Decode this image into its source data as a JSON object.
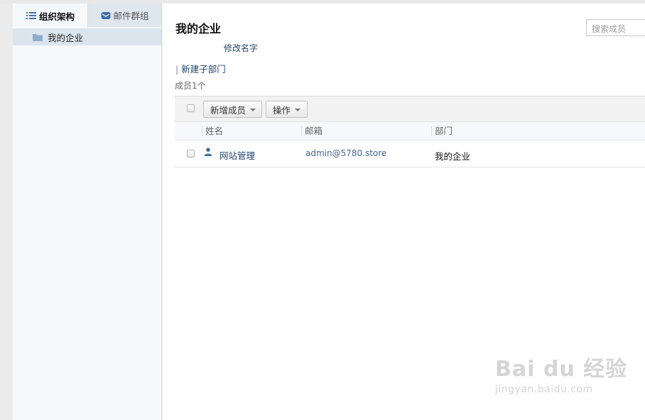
{
  "sidebar": {
    "tabs": [
      {
        "label": "组织架构",
        "icon": "list-icon",
        "active": true
      },
      {
        "label": "邮件群组",
        "icon": "mail-group-icon",
        "active": false
      }
    ],
    "tree": [
      {
        "label": "我的企业",
        "icon": "folder-icon",
        "selected": true
      }
    ]
  },
  "main": {
    "title": "我的企业",
    "rename_link": "修改名字",
    "new_subdept_link": "新建子部门",
    "member_count": "成员1个",
    "search_placeholder": "搜索成员",
    "toolbar": {
      "add_member_label": "新增成员",
      "actions_label": "操作"
    },
    "columns": [
      "姓名",
      "邮箱",
      "部门"
    ],
    "rows": [
      {
        "name": "网站管理",
        "email": "admin@5780.store",
        "department": "我的企业"
      }
    ]
  },
  "watermark": {
    "line1": "Bai du 经验",
    "line2": "jingyan.baidu.com"
  },
  "colors": {
    "link": "#22466e",
    "sidebar_bg": "#f6f9fb",
    "selected_bg": "#dbe5ee",
    "accent_icon": "#3d6ea8"
  }
}
